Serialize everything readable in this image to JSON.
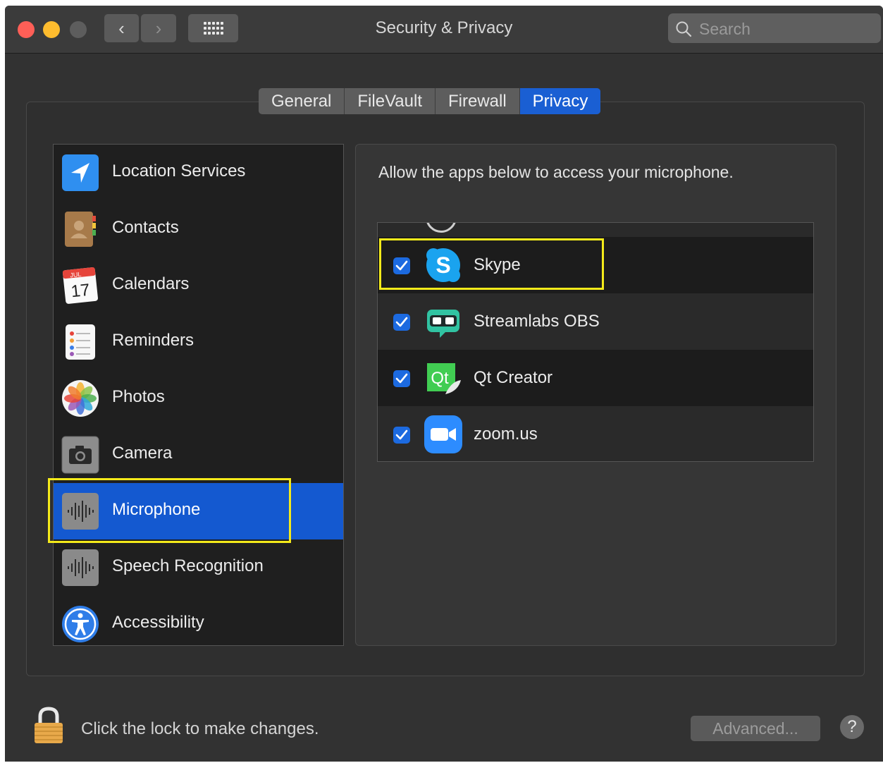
{
  "window": {
    "title": "Security & Privacy",
    "back_glyph": "‹",
    "forward_glyph": "›",
    "grid_icon": "show-all-icon"
  },
  "search": {
    "placeholder": "Search",
    "value": ""
  },
  "tabs": [
    {
      "label": "General",
      "active": false
    },
    {
      "label": "FileVault",
      "active": false
    },
    {
      "label": "Firewall",
      "active": false
    },
    {
      "label": "Privacy",
      "active": true
    }
  ],
  "sidebar": {
    "items": [
      {
        "label": "Location Services",
        "icon": "location-arrow-icon",
        "selected": false
      },
      {
        "label": "Contacts",
        "icon": "contacts-book-icon",
        "selected": false
      },
      {
        "label": "Calendars",
        "icon": "calendar-icon",
        "selected": false,
        "icon_month": "JUL",
        "icon_day": "17"
      },
      {
        "label": "Reminders",
        "icon": "reminders-list-icon",
        "selected": false
      },
      {
        "label": "Photos",
        "icon": "photos-flower-icon",
        "selected": false
      },
      {
        "label": "Camera",
        "icon": "camera-icon",
        "selected": false
      },
      {
        "label": "Microphone",
        "icon": "microphone-waveform-icon",
        "selected": true
      },
      {
        "label": "Speech Recognition",
        "icon": "speech-waveform-icon",
        "selected": false
      },
      {
        "label": "Accessibility",
        "icon": "accessibility-icon",
        "selected": false
      }
    ]
  },
  "main": {
    "prompt": "Allow the apps below to access your microphone.",
    "apps": [
      {
        "name": "Skype",
        "checked": true,
        "icon": "skype-icon",
        "icon_letter": "S"
      },
      {
        "name": "Streamlabs OBS",
        "checked": true,
        "icon": "streamlabs-icon"
      },
      {
        "name": "Qt Creator",
        "checked": true,
        "icon": "qt-creator-icon",
        "icon_letter": "Qt"
      },
      {
        "name": "zoom.us",
        "checked": true,
        "icon": "zoom-camera-icon"
      }
    ]
  },
  "footer": {
    "lock_text": "Click the lock to make changes.",
    "advanced_label": "Advanced...",
    "help_label": "?"
  },
  "colors": {
    "highlight": "#f4ea1a",
    "selection": "#1459d0",
    "checkbox": "#1c6ae0"
  }
}
